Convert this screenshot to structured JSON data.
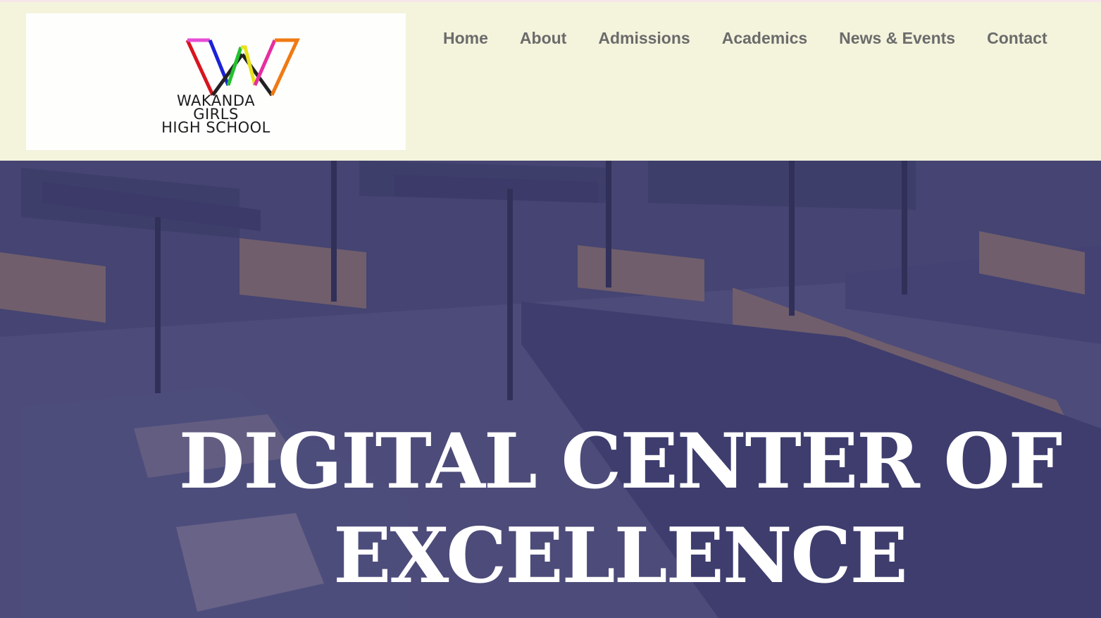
{
  "logo": {
    "line1": "WAKANDA",
    "line2": "GIRLS",
    "line3": "HIGH SCHOOL",
    "colors": [
      "#e84bd6",
      "#1b22d8",
      "#23c12e",
      "#e8e21b",
      "#e62fa0",
      "#f07a12",
      "#d8141e",
      "#222222"
    ]
  },
  "nav": {
    "items": [
      {
        "label": "Home"
      },
      {
        "label": "About"
      },
      {
        "label": "Admissions"
      },
      {
        "label": "Academics"
      },
      {
        "label": "News & Events"
      },
      {
        "label": "Contact"
      }
    ]
  },
  "hero": {
    "title_line1": "DIGITAL CENTER OF",
    "title_line2": "EXCELLENCE"
  },
  "colors": {
    "header_bg": "#f4f3dc",
    "nav_text": "#6b6b6b",
    "hero_overlay": "#34346e",
    "hero_text": "#ffffff"
  }
}
